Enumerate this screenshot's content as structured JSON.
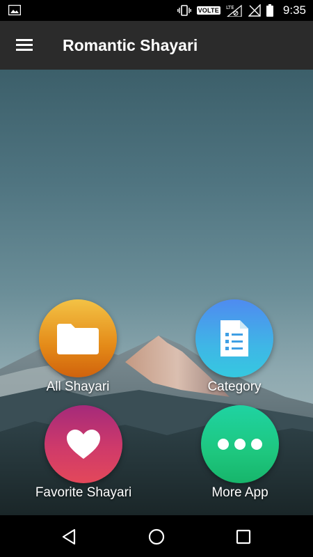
{
  "status_bar": {
    "time": "9:35",
    "volte": "VOLTE",
    "icons": [
      "image-icon",
      "vibrate-icon",
      "volte-icon",
      "signal-lte-icon",
      "no-sim-icon",
      "battery-icon"
    ]
  },
  "app_bar": {
    "title": "Romantic Shayari",
    "menu_icon": "hamburger-menu-icon"
  },
  "menu": {
    "items": [
      {
        "label": "All Shayari",
        "icon": "folder-icon",
        "color": "#e48a18"
      },
      {
        "label": "Category",
        "icon": "document-list-icon",
        "color": "#3fb6e6"
      },
      {
        "label": "Favorite Shayari",
        "icon": "heart-icon",
        "color": "#cf3a6a"
      },
      {
        "label": "More App",
        "icon": "more-dots-icon",
        "color": "#1ec77f"
      }
    ]
  },
  "nav_bar": {
    "icons": [
      "back-icon",
      "home-icon",
      "recents-icon"
    ]
  },
  "colors": {
    "app_bar": "#2b2b2b",
    "status_bar": "#000000",
    "nav_bar": "#000000"
  }
}
